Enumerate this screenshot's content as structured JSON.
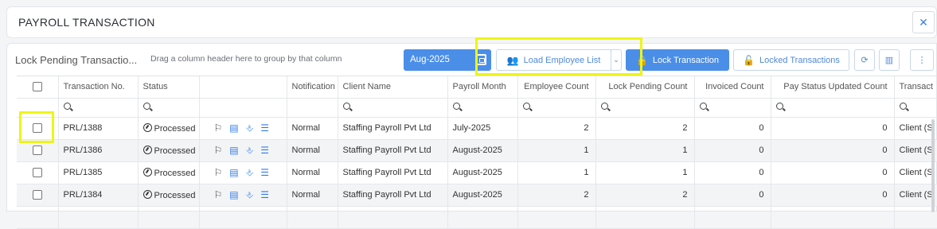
{
  "header": {
    "title": "PAYROLL TRANSACTION",
    "close_icon": "close-icon"
  },
  "toolbar": {
    "grid_title": "Lock Pending Transactio...",
    "group_hint": "Drag a column header here to group by that column",
    "month": "Aug-2025",
    "load_employee_list": "Load Employee List",
    "lock_transaction": "Lock Transaction",
    "locked_transactions": "Locked Transactions"
  },
  "columns": {
    "transaction_no": "Transaction No.",
    "status": "Status",
    "notification": "Notification",
    "client_name": "Client Name",
    "payroll_month": "Payroll Month",
    "employee_count": "Employee Count",
    "lock_pending_count": "Lock Pending Count",
    "invoiced_count": "Invoiced Count",
    "pay_status_updated_count": "Pay Status Updated Count",
    "transaction_type": "Transact"
  },
  "rows": [
    {
      "transaction_no": "PRL/1388",
      "status": "Processed",
      "notification": "Normal",
      "client_name": "Staffing Payroll Pvt Ltd",
      "payroll_month": "July-2025",
      "employee_count": "2",
      "lock_pending_count": "2",
      "invoiced_count": "0",
      "pay_status_updated_count": "0",
      "transaction_type": "Client (S"
    },
    {
      "transaction_no": "PRL/1386",
      "status": "Processed",
      "notification": "Normal",
      "client_name": "Staffing Payroll Pvt Ltd",
      "payroll_month": "August-2025",
      "employee_count": "1",
      "lock_pending_count": "1",
      "invoiced_count": "0",
      "pay_status_updated_count": "0",
      "transaction_type": "Client (S"
    },
    {
      "transaction_no": "PRL/1385",
      "status": "Processed",
      "notification": "Normal",
      "client_name": "Staffing Payroll Pvt Ltd",
      "payroll_month": "August-2025",
      "employee_count": "1",
      "lock_pending_count": "1",
      "invoiced_count": "0",
      "pay_status_updated_count": "0",
      "transaction_type": "Client (S"
    },
    {
      "transaction_no": "PRL/1384",
      "status": "Processed",
      "notification": "Normal",
      "client_name": "Staffing Payroll Pvt Ltd",
      "payroll_month": "August-2025",
      "employee_count": "2",
      "lock_pending_count": "2",
      "invoiced_count": "0",
      "pay_status_updated_count": "0",
      "transaction_type": "Client (S"
    }
  ],
  "colors": {
    "accent": "#4a8ee8",
    "highlight": "#eef516",
    "link_blue": "#2f7be6"
  }
}
